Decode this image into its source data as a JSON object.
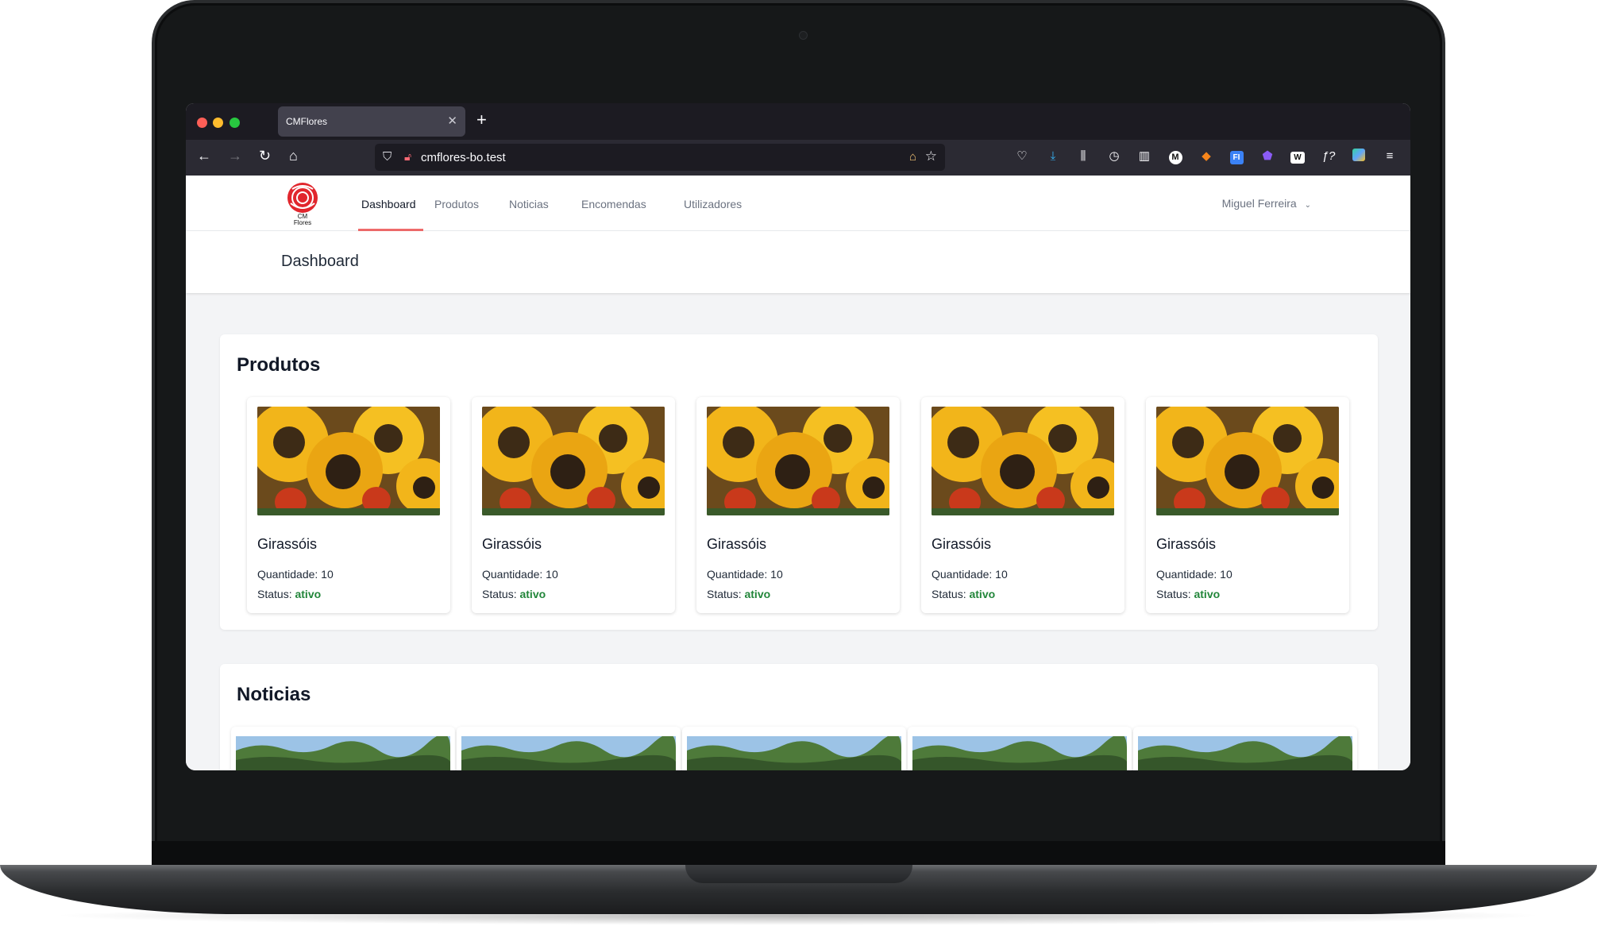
{
  "browser": {
    "tab_title": "CMFlores",
    "url": "cmflores-bo.test"
  },
  "app": {
    "logo_text": "CM Flores",
    "nav": [
      "Dashboard",
      "Produtos",
      "Noticias",
      "Encomendas",
      "Utilizadores"
    ],
    "active_nav": "Dashboard",
    "user_name": "Miguel Ferreira",
    "accent_color": "#ef6b6b"
  },
  "page": {
    "title": "Dashboard"
  },
  "produtos": {
    "title": "Produtos",
    "items": [
      {
        "name": "Girassóis",
        "quantity_label": "Quantidade: 10",
        "status_label": "Status:",
        "status_value": "ativo"
      },
      {
        "name": "Girassóis",
        "quantity_label": "Quantidade: 10",
        "status_label": "Status:",
        "status_value": "ativo"
      },
      {
        "name": "Girassóis",
        "quantity_label": "Quantidade: 10",
        "status_label": "Status:",
        "status_value": "ativo"
      },
      {
        "name": "Girassóis",
        "quantity_label": "Quantidade: 10",
        "status_label": "Status:",
        "status_value": "ativo"
      },
      {
        "name": "Girassóis",
        "quantity_label": "Quantidade: 10",
        "status_label": "Status:",
        "status_value": "ativo"
      }
    ]
  },
  "noticias": {
    "title": "Noticias"
  }
}
